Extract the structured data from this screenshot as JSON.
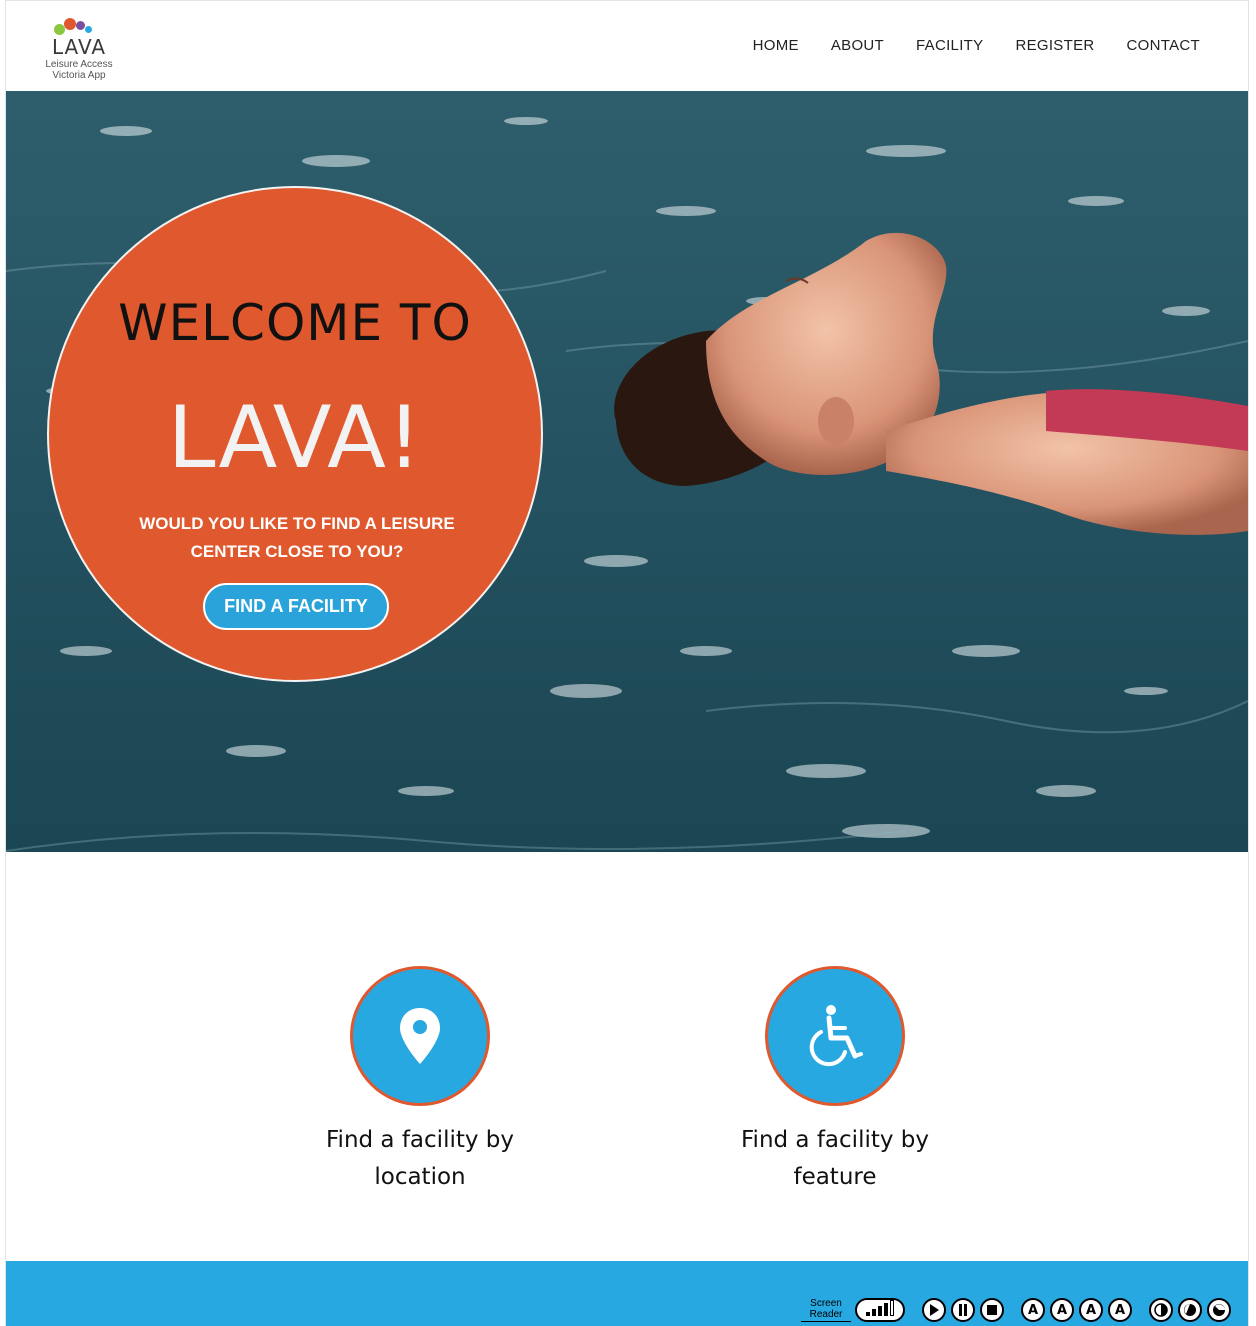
{
  "header": {
    "logo": {
      "wordmark": "LAVA",
      "line1": "Leisure Access",
      "line2": "Victoria App",
      "dot_colors": [
        "#8dc63f",
        "#e0582d",
        "#7a4f9e",
        "#28a8e0"
      ]
    },
    "nav": [
      "HOME",
      "ABOUT",
      "FACILITY",
      "REGISTER",
      "CONTACT"
    ]
  },
  "hero": {
    "image": "woman-floating-in-pool",
    "welcome": "WELCOME TO",
    "brand": "LAVA!",
    "question": "WOULD YOU LIKE TO FIND A LEISURE CENTER CLOSE TO YOU?",
    "cta": "FIND A FACILITY",
    "accent_color": "#e0582d",
    "button_color": "#29a3d9"
  },
  "features": [
    {
      "icon": "location-pin-icon",
      "line1": "Find a facility by",
      "line2": "location"
    },
    {
      "icon": "wheelchair-icon",
      "line1": "Find a facility by",
      "line2": "feature"
    }
  ],
  "footer": {
    "color": "#28a8e0",
    "screen_reader": {
      "line1": "Screen",
      "line2": "Reader"
    },
    "controls": [
      "play-icon",
      "pause-icon",
      "stop-icon",
      "font-size-increase-icon",
      "font-size-decrease-icon",
      "font-size-reset-icon",
      "font-default-icon",
      "contrast-icon",
      "contrast-invert-icon",
      "contrast-reset-icon"
    ]
  }
}
